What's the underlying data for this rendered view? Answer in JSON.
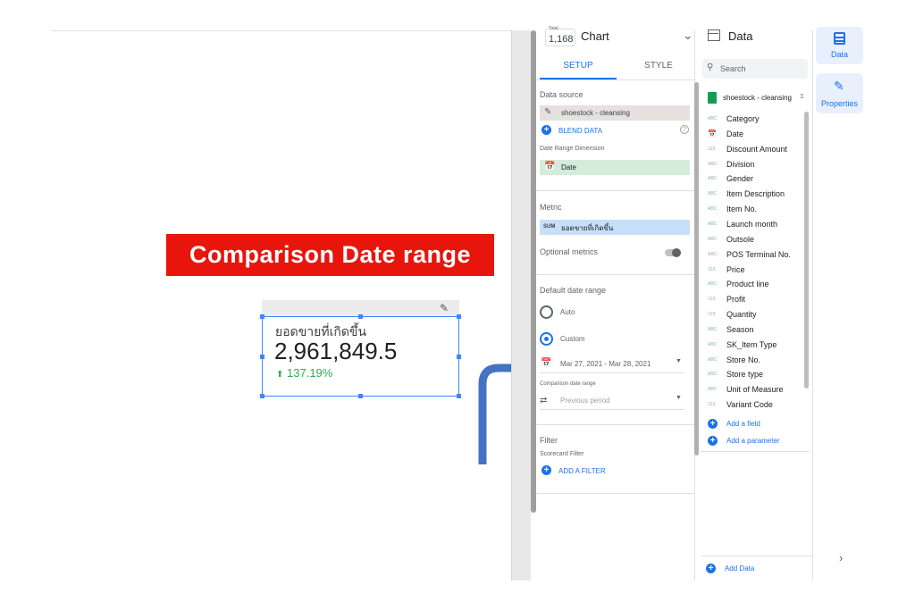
{
  "canvas": {
    "banner_text": "Comparison Date range",
    "scorecard": {
      "label": "ยอดขายที่เกิดขึ้น",
      "value": "2,961,849.5",
      "delta": "137.19%"
    }
  },
  "setup_panel": {
    "header": {
      "badge_top": "Total",
      "badge_value": "1,168",
      "title": "Chart"
    },
    "tabs": {
      "setup": "SETUP",
      "style": "STYLE"
    },
    "data_source": {
      "label": "Data source",
      "value": "shoestock - cleansing",
      "blend_label": "BLEND DATA"
    },
    "date_range_dimension": {
      "label": "Date Range Dimension",
      "value": "Date"
    },
    "metric": {
      "label": "Metric",
      "agg": "SUM",
      "value": "ยอดขายที่เกิดขึ้น"
    },
    "optional_metrics": {
      "label": "Optional metrics"
    },
    "default_date_range": {
      "label": "Default date range",
      "auto_label": "Auto",
      "custom_label": "Custom",
      "custom_value": "Mar 27, 2021 - Mar 28, 2021",
      "comparison_label": "Comparison date range",
      "comparison_value": "Previous period"
    },
    "filter": {
      "label": "Filter",
      "sub_label": "Scorecard Filter",
      "add_label": "ADD A FILTER"
    }
  },
  "data_panel": {
    "title": "Data",
    "search_placeholder": "Search",
    "source_name": "shoestock - cleansing",
    "fields": [
      {
        "type": "ABC",
        "name": "Category"
      },
      {
        "type": "date",
        "name": "Date"
      },
      {
        "type": "123",
        "name": "Discount Amount"
      },
      {
        "type": "ABC",
        "name": "Division"
      },
      {
        "type": "ABC",
        "name": "Gender"
      },
      {
        "type": "ABC",
        "name": "Item Description"
      },
      {
        "type": "ABC",
        "name": "Item No."
      },
      {
        "type": "ABC",
        "name": "Launch month"
      },
      {
        "type": "ABC",
        "name": "Outsole"
      },
      {
        "type": "ABC",
        "name": "POS Terminal No."
      },
      {
        "type": "123",
        "name": "Price"
      },
      {
        "type": "ABC",
        "name": "Product line"
      },
      {
        "type": "123",
        "name": "Profit"
      },
      {
        "type": "123",
        "name": "Quantity"
      },
      {
        "type": "ABC",
        "name": "Season"
      },
      {
        "type": "ABC",
        "name": "SK_Item Type"
      },
      {
        "type": "ABC",
        "name": "Store No."
      },
      {
        "type": "ABC",
        "name": "Store type"
      },
      {
        "type": "ABC",
        "name": "Unit of Measure"
      },
      {
        "type": "123",
        "name": "Variant Code"
      }
    ],
    "add_field_label": "Add a field",
    "add_parameter_label": "Add a parameter",
    "add_data_label": "Add Data"
  },
  "right_rail": {
    "data_label": "Data",
    "properties_label": "Properties"
  },
  "colors": {
    "banner": "#e8150d",
    "accent": "#1a73e8",
    "positive": "#34a853",
    "dimension_chip": "#d4edda",
    "metric_chip": "#c6dffb",
    "arrow": "#4472c4"
  }
}
